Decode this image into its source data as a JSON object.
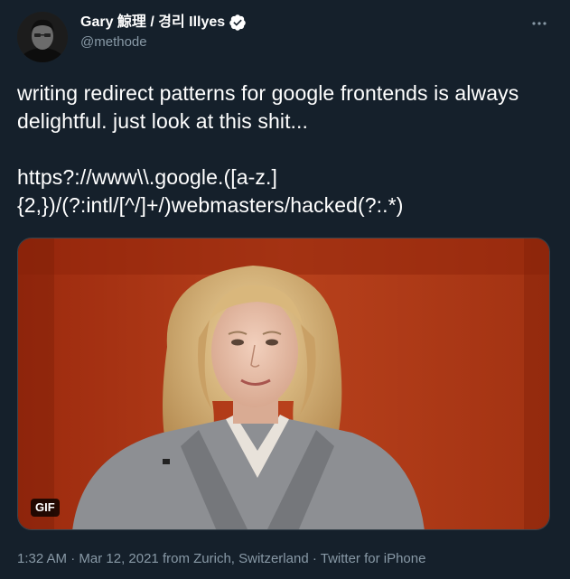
{
  "author": {
    "display_name": "Gary 鯨理 / 경리 Illyes",
    "handle": "@methode",
    "verified": true
  },
  "tweet": {
    "text": "writing redirect patterns for google frontends is always delightful. just look at this shit...\n\nhttps?://www\\\\.google.([a-z.]\n{2,})/(?:intl/[^/]+/)webmasters/hacked(?:.*)",
    "media_badge": "GIF"
  },
  "meta": {
    "time": "1:32 AM",
    "separator1": " · ",
    "date": "Mar 12, 2021",
    "location": " from Zurich, Switzerland",
    "separator2": " · ",
    "source": "Twitter for iPhone"
  },
  "colors": {
    "background": "#15202b",
    "text": "#ffffff",
    "secondary_text": "#8899a6",
    "verified": "#ffffff",
    "border": "#38444d"
  },
  "icons": {
    "verified": "verified-badge-icon",
    "more": "more-dots-icon"
  }
}
